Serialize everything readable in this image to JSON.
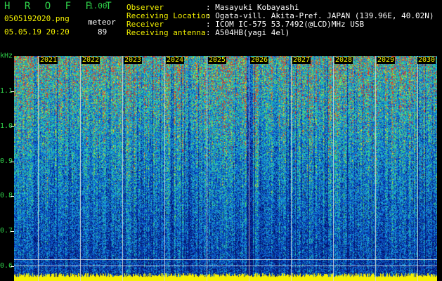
{
  "header": {
    "app_title": "H R O F F T",
    "version": "1.00",
    "filename": "0505192020.png",
    "datetime": "05.05.19 20:20",
    "mode_label": "meteor",
    "count": "89"
  },
  "info": {
    "labels": [
      "Observer",
      "Receiving Location",
      "Receiver",
      "Receiving antenna"
    ],
    "values": [
      ": Masayuki Kobayashi",
      ": Ogata-vill. Akita-Pref. JAPAN (139.96E, 40.02N)",
      ": ICOM IC-575 53.7492(@LCD)MHz USB",
      ": A504HB(yagi 4el)"
    ]
  },
  "axis": {
    "unit": "kHz",
    "y_ticks": [
      "1.1",
      "1.0",
      "0.9",
      "0.8",
      "0.7",
      "0.6"
    ],
    "x_ticks": [
      "2021",
      "2022",
      "2023",
      "2024",
      "2025",
      "2026",
      "2027",
      "2028",
      "2029",
      "2030"
    ]
  },
  "colors": {
    "background": "#000000",
    "label_green": "#2fd24a",
    "label_yellow": "#f2f000",
    "spectrum_base": "#04135e",
    "baseline_yellow": "#f5f000"
  }
}
